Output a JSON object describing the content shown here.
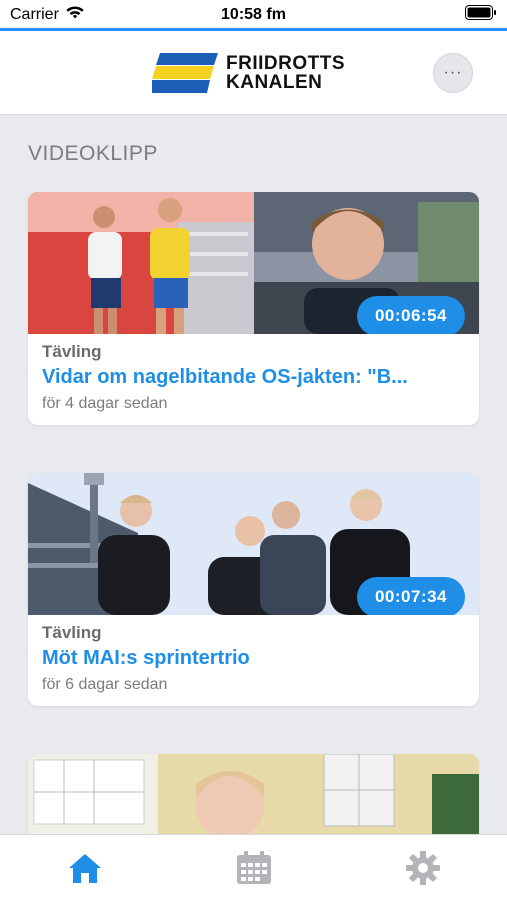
{
  "status": {
    "carrier": "Carrier",
    "time": "10:58 fm"
  },
  "header": {
    "logo_line1": "FRIIDROTTS",
    "logo_line2": "KANALEN",
    "more_label": "···"
  },
  "section": {
    "title": "VIDEOKLIPP"
  },
  "videos": [
    {
      "category": "Tävling",
      "title": "Vidar om nagelbitande OS-jakten: \"B...",
      "time_ago": "för 4 dagar sedan",
      "duration": "00:06:54"
    },
    {
      "category": "Tävling",
      "title": "Möt MAI:s sprintertrio",
      "time_ago": "för 6 dagar sedan",
      "duration": "00:07:34"
    }
  ],
  "tabs": [
    {
      "icon": "home-icon",
      "active": true
    },
    {
      "icon": "calendar-icon",
      "active": false
    },
    {
      "icon": "gear-icon",
      "active": false
    }
  ],
  "colors": {
    "accent": "#1e8ee6",
    "logo_blue": "#1c5fb8",
    "logo_yellow": "#f4d21f",
    "inactive_icon": "#b3b3b8"
  }
}
